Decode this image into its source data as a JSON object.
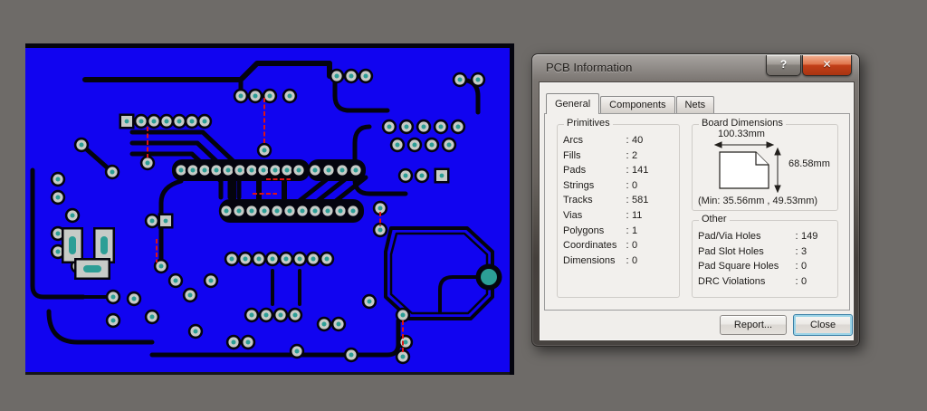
{
  "theme": {
    "colors": {
      "desktop": "#6e6b68",
      "board": "#1104f0",
      "trace": "#04040e",
      "padring": "#c7cbc7",
      "hole": "#2c9e96",
      "rats": "#de1414",
      "close-red": "#c24018",
      "focus-blue": "#9bd4e8"
    }
  },
  "pcb_view": {
    "description": "PCB bottom-layer layout view"
  },
  "dialog": {
    "title": "PCB Information",
    "separator": ":",
    "titlebar": {
      "help_glyph": "?",
      "close_glyph": "✕"
    },
    "tabs": [
      {
        "label": "General"
      },
      {
        "label": "Components"
      },
      {
        "label": "Nets"
      }
    ],
    "primitives": {
      "title": "Primitives",
      "rows": [
        {
          "label": "Arcs",
          "value": "40"
        },
        {
          "label": "Fills",
          "value": "2"
        },
        {
          "label": "Pads",
          "value": "141"
        },
        {
          "label": "Strings",
          "value": "0"
        },
        {
          "label": "Tracks",
          "value": "581"
        },
        {
          "label": "Vias",
          "value": "11"
        },
        {
          "label": "Polygons",
          "value": "1"
        },
        {
          "label": "Coordinates",
          "value": "0"
        },
        {
          "label": "Dimensions",
          "value": "0"
        }
      ]
    },
    "board_dimensions": {
      "title": "Board Dimensions",
      "width_label": "100.33mm",
      "height_label": "68.58mm",
      "min_label": "(Min: 35.56mm , 49.53mm)"
    },
    "other": {
      "title": "Other",
      "rows": [
        {
          "label": "Pad/Via Holes",
          "value": "149"
        },
        {
          "label": "Pad Slot Holes",
          "value": "3"
        },
        {
          "label": "Pad Square Holes",
          "value": "0"
        },
        {
          "label": "DRC Violations",
          "value": "0"
        }
      ]
    },
    "buttons": {
      "report": "Report...",
      "close": "Close"
    }
  }
}
